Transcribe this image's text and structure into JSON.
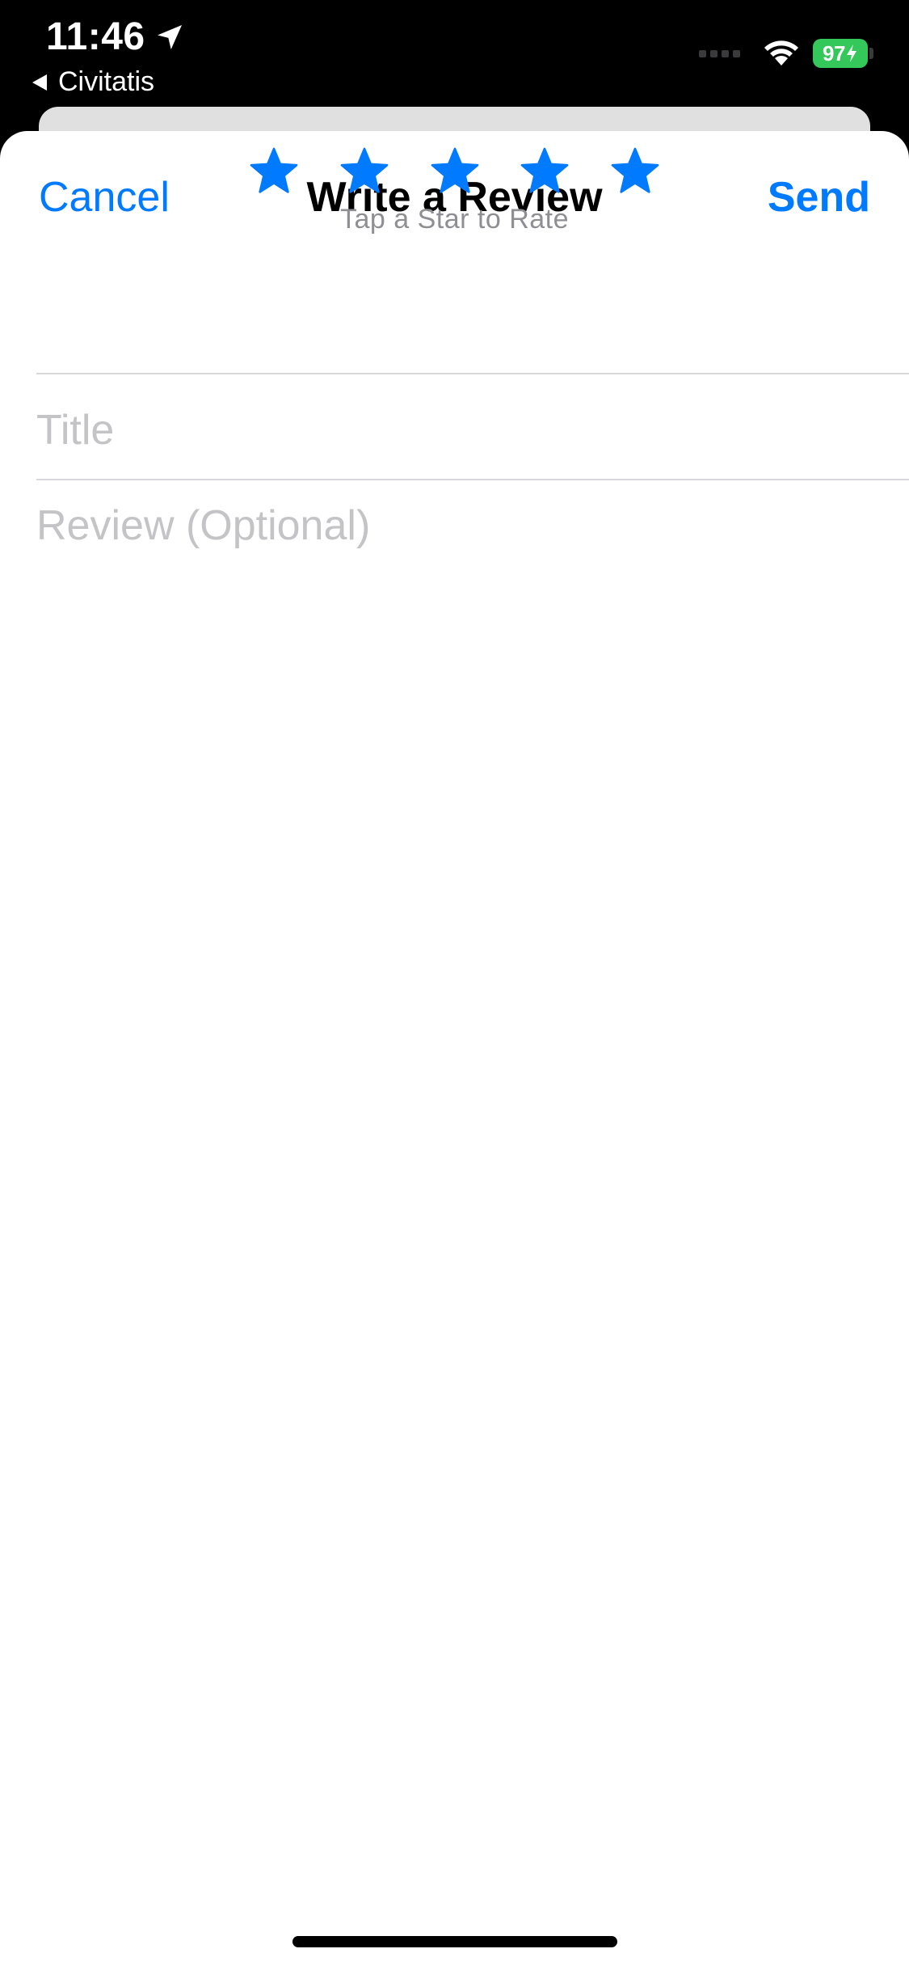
{
  "status_bar": {
    "time": "11:46",
    "back_app": "Civitatis",
    "battery_level": "97",
    "location_icon": "location-arrow-icon",
    "wifi_icon": "wifi-icon",
    "battery_icon": "battery-charging-icon"
  },
  "nav": {
    "cancel_label": "Cancel",
    "title": "Write a Review",
    "send_label": "Send"
  },
  "rating": {
    "star_count": 5,
    "star_icon": "star-icon",
    "hint": "Tap a Star to Rate"
  },
  "form": {
    "title_placeholder": "Title",
    "title_value": "",
    "review_placeholder": "Review (Optional)",
    "review_value": ""
  },
  "colors": {
    "accent": "#007aff",
    "battery": "#34c759",
    "placeholder": "#c4c4c7",
    "hint_text": "#8e8e93"
  }
}
